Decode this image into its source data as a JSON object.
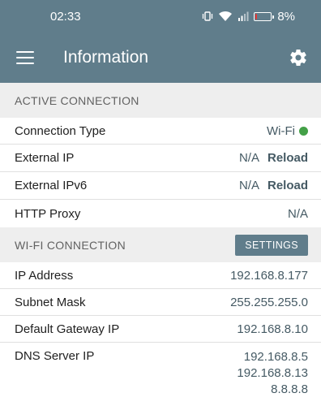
{
  "status_bar": {
    "time": "02:33",
    "battery": "8%",
    "battery_level": 0.08,
    "battery_color": "#e53935"
  },
  "app_bar": {
    "title": "Information",
    "menu_icon": "hamburger-menu-icon",
    "settings_icon": "gear-icon"
  },
  "active_connection": {
    "header": "ACTIVE CONNECTION",
    "rows": [
      {
        "label": "Connection Type",
        "value": "Wi-Fi",
        "status_color": "#43a047"
      },
      {
        "label": "External IP",
        "value": "N/A",
        "action": "Reload"
      },
      {
        "label": "External IPv6",
        "value": "N/A",
        "action": "Reload"
      },
      {
        "label": "HTTP Proxy",
        "value": "N/A"
      }
    ]
  },
  "wifi_connection": {
    "header": "WI-FI CONNECTION",
    "settings_label": "SETTINGS",
    "rows": [
      {
        "label": "IP Address",
        "value": "192.168.8.177"
      },
      {
        "label": "Subnet Mask",
        "value": "255.255.255.0"
      },
      {
        "label": "Default Gateway IP",
        "value": "192.168.8.10"
      },
      {
        "label": "DNS Server IP",
        "values": [
          "192.168.8.5",
          "192.168.8.13",
          "8.8.8.8"
        ]
      }
    ]
  },
  "colors": {
    "primary": "#607d8b",
    "accent_text": "#455a64",
    "section_bg": "#eeeeee"
  }
}
